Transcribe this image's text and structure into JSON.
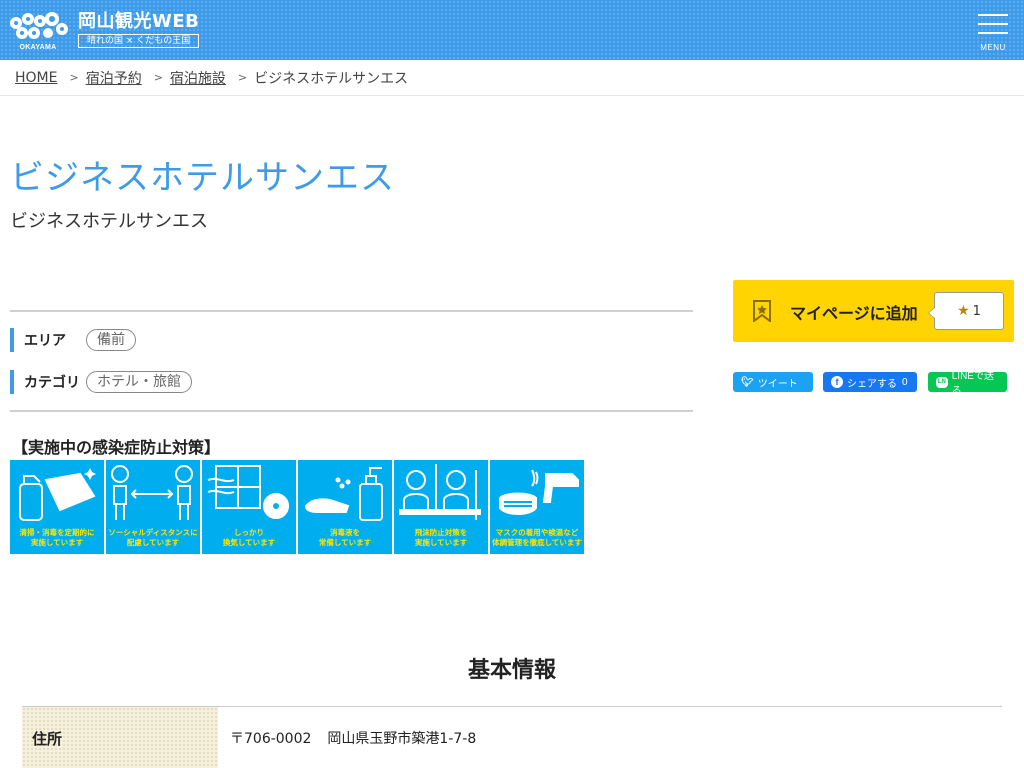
{
  "header": {
    "logo_title": "岡山観光WEB",
    "logo_sub": "晴れの国 × くだもの王国",
    "logo_mark_text": "OKAYAMA",
    "menu_label": "MENU",
    "bg_color": "#3d9be9"
  },
  "breadcrumb": [
    {
      "label": "HOME"
    },
    {
      "label": "宿泊予約"
    },
    {
      "label": "宿泊施設"
    },
    {
      "label": "ビジネスホテルサンエス"
    }
  ],
  "page": {
    "title": "ビジネスホテルサンエス",
    "subtitle": "ビジネスホテルサンエス"
  },
  "meta": {
    "area_label": "エリア",
    "area_value": "備前",
    "category_label": "カテゴリ",
    "category_value": "ホテル・旅館"
  },
  "infection": {
    "title": "【実施中の感染症防止対策】",
    "items": [
      {
        "icon": "spray-wipe-icon",
        "caption": "清掃・消毒を定期的に\n実施しています"
      },
      {
        "icon": "social-distance-icon",
        "caption": "ソーシャルディスタンスに\n配慮しています"
      },
      {
        "icon": "ventilation-icon",
        "caption": "しっかり\n換気しています"
      },
      {
        "icon": "sanitizer-icon",
        "caption": "消毒液を\n常備しています"
      },
      {
        "icon": "partition-icon",
        "caption": "飛沫防止対策を\n実施しています"
      },
      {
        "icon": "mask-thermometer-icon",
        "caption": "マスクの着用や検温など\n体調管理を徹底しています"
      }
    ],
    "tile_color": "#00aeef",
    "caption_color": "#ffe400"
  },
  "mypage": {
    "label": "マイページに追加",
    "count": "1",
    "color": "#ffd400"
  },
  "share": {
    "tweet_label": "ツイート",
    "fb_label": "シェアする",
    "fb_count": "0",
    "line_label": "LINEで送る",
    "twitter_color": "#1da1f2",
    "fb_color": "#1877f2",
    "line_color": "#06c755"
  },
  "basic_info": {
    "title": "基本情報",
    "rows": [
      {
        "label": "住所",
        "zip": "〒706-0002",
        "value": "岡山県玉野市築港1-7-8"
      }
    ]
  }
}
